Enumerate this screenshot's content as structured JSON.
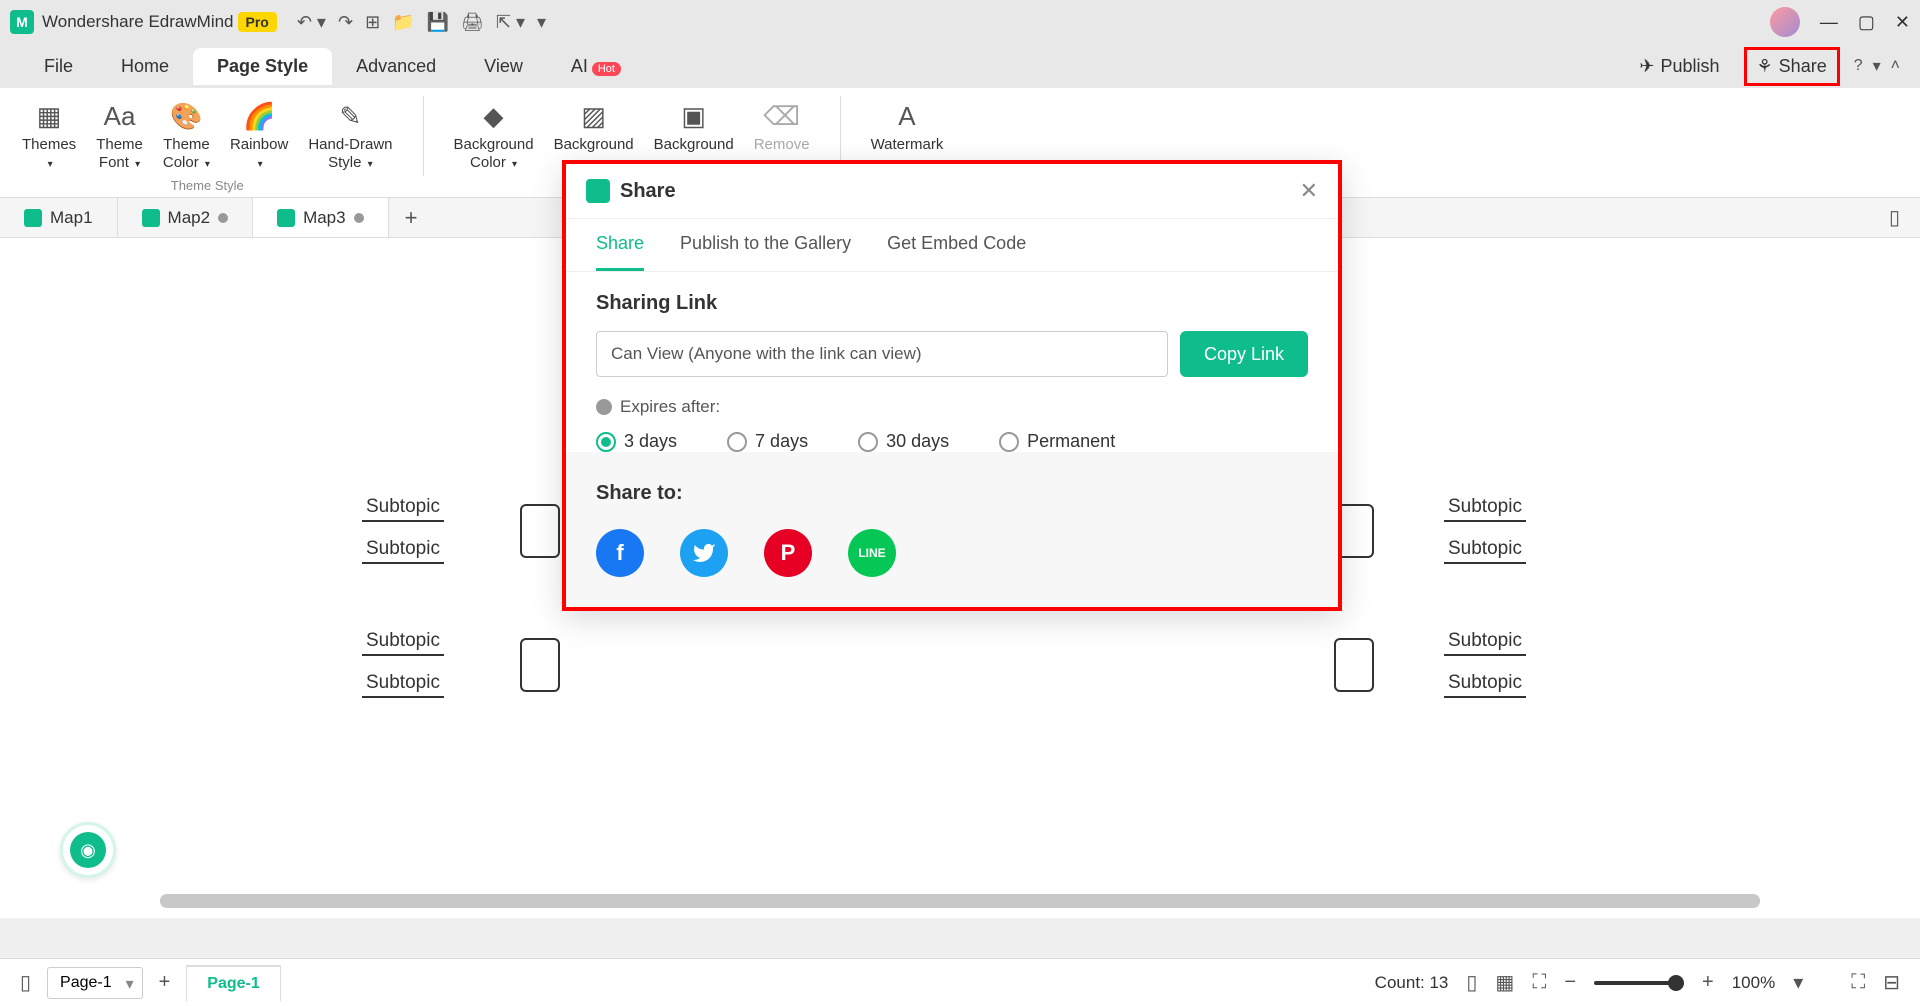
{
  "app": {
    "name": "Wondershare EdrawMind",
    "badge": "Pro"
  },
  "menubar": {
    "items": [
      "File",
      "Home",
      "Page Style",
      "Advanced",
      "View",
      "AI"
    ],
    "active": "Page Style",
    "hot": "Hot",
    "publish": "Publish",
    "share": "Share"
  },
  "ribbon": {
    "group1": {
      "themes": "Themes",
      "themeFont": "Theme\nFont",
      "themeColor": "Theme\nColor",
      "rainbow": "Rainbow",
      "handDrawn": "Hand-Drawn\nStyle",
      "caption": "Theme Style"
    },
    "group2": {
      "bgColor": "Background\nColor",
      "bg1": "Background",
      "bg2": "Background",
      "remove": "Remove"
    },
    "group3": {
      "watermark": "Watermark"
    }
  },
  "tabs": {
    "map1": "Map1",
    "map2": "Map2",
    "map3": "Map3"
  },
  "canvas": {
    "subtopic": "Subtopic"
  },
  "dialog": {
    "title": "Share",
    "tabs": {
      "share": "Share",
      "publish": "Publish to the Gallery",
      "embed": "Get Embed Code"
    },
    "sharingLink": "Sharing Link",
    "linkValue": "Can View (Anyone with the link can view)",
    "copyLink": "Copy Link",
    "expiresAfter": "Expires after:",
    "opts": {
      "d3": "3 days",
      "d7": "7 days",
      "d30": "30 days",
      "perm": "Permanent"
    },
    "shareTo": "Share to:"
  },
  "status": {
    "pageSelect": "Page-1",
    "pageActive": "Page-1",
    "count": "Count: 13",
    "zoom": "100%"
  }
}
